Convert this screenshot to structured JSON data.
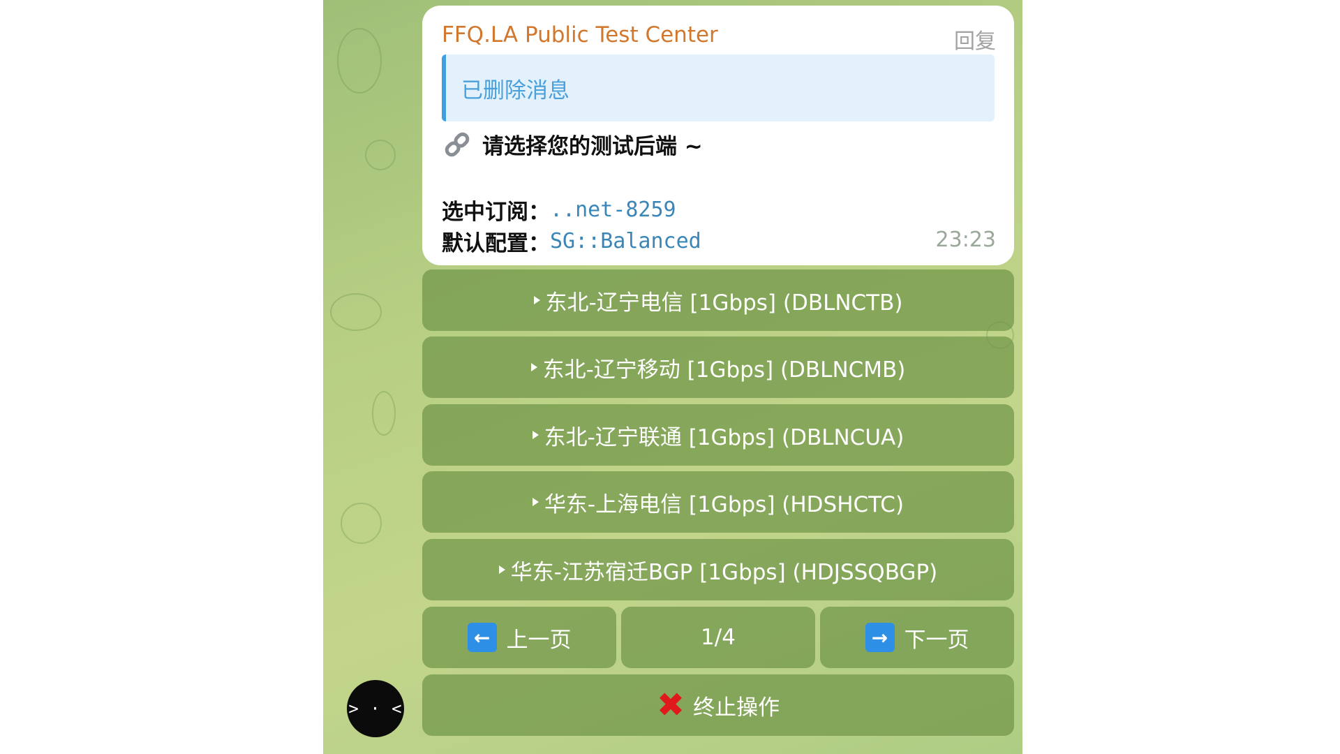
{
  "message": {
    "sender": "FFQ.LA Public Test Center",
    "reply_label": "回复",
    "quoted_text": "已删除消息",
    "prompt_text": "请选择您的测试后端 ~",
    "subscription_label": "选中订阅：",
    "subscription_value": "..net-8259",
    "config_label": "默认配置：",
    "config_value": "SG::Balanced",
    "time": "23:23"
  },
  "keyboard": {
    "backends": [
      {
        "label": "东北-辽宁电信 [1Gbps] (DBLNCTB)"
      },
      {
        "label": "东北-辽宁移动 [1Gbps] (DBLNCMB)"
      },
      {
        "label": "东北-辽宁联通 [1Gbps] (DBLNCUA)"
      },
      {
        "label": "华东-上海电信 [1Gbps] (HDSHCTC)"
      },
      {
        "label": "华东-江苏宿迁BGP [1Gbps] (HDJSSQBGP)"
      }
    ],
    "prev_label": "上一页",
    "page_indicator": "1/4",
    "next_label": "下一页",
    "abort_label": "终止操作"
  },
  "avatar": {
    "face": "> · <"
  },
  "colors": {
    "sender": "#d2782e",
    "quote_accent": "#3f9fe0",
    "mono_value": "#3a86b8",
    "button_bg": "#70964a",
    "arrow_icon": "#2e8fe6",
    "abort_icon": "#e0191d"
  },
  "icons": {
    "prompt": "link-icon",
    "prev": "left-arrow-icon",
    "next": "right-arrow-icon",
    "abort": "cross-mark-icon"
  }
}
